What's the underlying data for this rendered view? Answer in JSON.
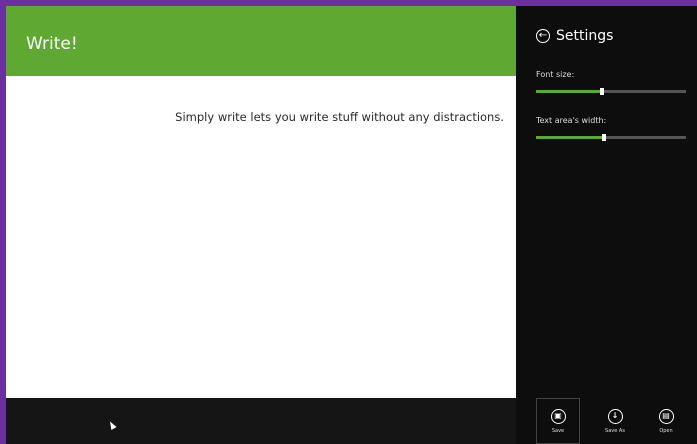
{
  "app": {
    "title": "Write!"
  },
  "editor": {
    "text": "Simply write lets you write stuff without any distractions."
  },
  "settings": {
    "title": "Settings",
    "font_size": {
      "label": "Font size:",
      "value_fraction": 0.44
    },
    "text_area_width": {
      "label": "Text area's width:",
      "value_fraction": 0.45
    }
  },
  "app_bar": {
    "commands": [
      {
        "label": "Save",
        "icon": "save-icon",
        "selected": true
      },
      {
        "label": "Save As",
        "icon": "save-as-icon",
        "selected": false
      },
      {
        "label": "Open",
        "icon": "open-icon",
        "selected": false
      }
    ]
  },
  "colors": {
    "accent": "#5fa832",
    "frame": "#6b2fa0",
    "panel": "#0d0d0d"
  }
}
